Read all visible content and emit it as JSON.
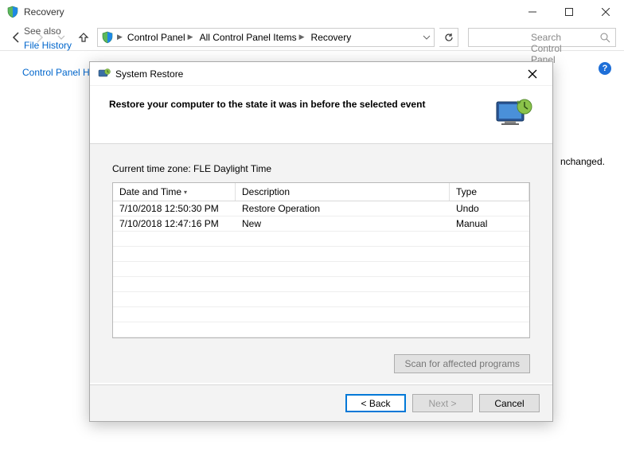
{
  "window": {
    "title": "Recovery",
    "breadcrumbs": [
      "Control Panel",
      "All Control Panel Items",
      "Recovery"
    ],
    "search_placeholder": "Search Control Panel",
    "cp_home": "Control Panel H",
    "see_also": "See also",
    "file_history": "File History",
    "unchanged_fragment": "nchanged.",
    "help": "?"
  },
  "dialog": {
    "title": "System Restore",
    "heading": "Restore your computer to the state it was in before the selected event",
    "timezone_label": "Current time zone: FLE Daylight Time",
    "columns": {
      "date": "Date and Time",
      "desc": "Description",
      "type": "Type"
    },
    "rows": [
      {
        "date": "7/10/2018 12:50:30 PM",
        "desc": "Restore Operation",
        "type": "Undo"
      },
      {
        "date": "7/10/2018 12:47:16 PM",
        "desc": "New",
        "type": "Manual"
      }
    ],
    "scan_button": "Scan for affected programs",
    "back": "< Back",
    "next": "Next >",
    "cancel": "Cancel"
  },
  "icons": {
    "shield": "shield-icon",
    "monitor_clock": "monitor-clock-icon"
  }
}
